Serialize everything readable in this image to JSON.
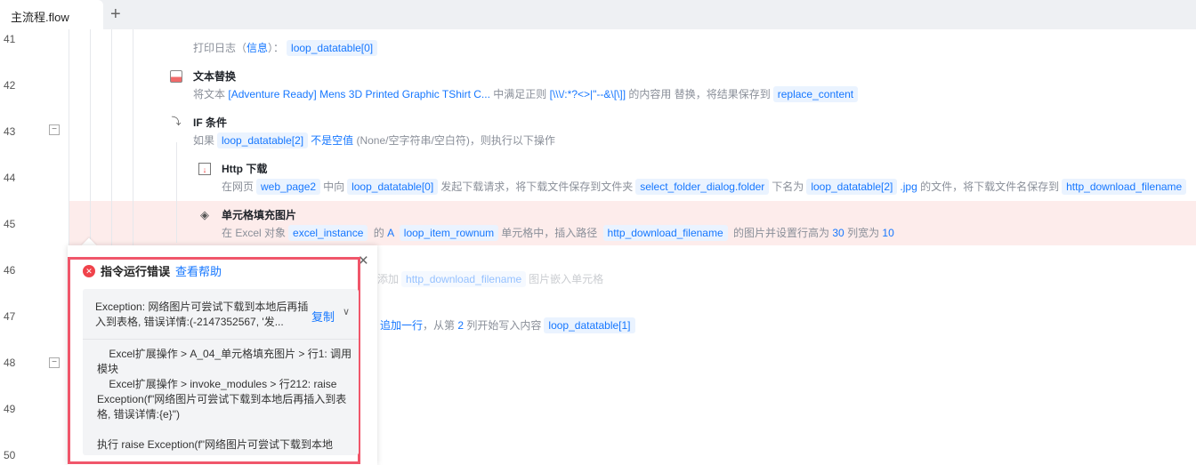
{
  "tabs": {
    "active": "主流程.flow",
    "add": "+"
  },
  "line_numbers": [
    "41",
    "42",
    "43",
    "44",
    "45",
    "46",
    "47",
    "48",
    "49",
    "50"
  ],
  "rows": {
    "r41": {
      "desc_prefix": "打印日志（",
      "level": "信息",
      "desc_mid": "）：",
      "var": "loop_datatable[0]"
    },
    "r42": {
      "title": "文本替换",
      "p1": "将文本",
      "text": "[Adventure Ready] Mens 3D Printed Graphic TShirt C...",
      "p2": "中满足正则",
      "regex": "[\\\\\\/:*?<>|\"--&\\[\\]]",
      "p3": "的内容用  替换，将结果保存到",
      "var": "replace_content"
    },
    "r43": {
      "title": "IF 条件",
      "p1": "如果",
      "var": "loop_datatable[2]",
      "cond": "不是空值",
      "p2": "(None/空字符串/空白符)，则执行以下操作"
    },
    "r44": {
      "title": "Http 下载",
      "p1": "在网页",
      "v1": "web_page2",
      "p2": "中向",
      "v2": "loop_datatable[0]",
      "p3": "发起下载请求，将下载文件保存到文件夹",
      "v3": "select_folder_dialog.folder",
      "p4": "下名为",
      "v4": "loop_datatable[2]",
      "ext": ".jpg",
      "p5": "的文件，将下载文件名保存到",
      "v5": "http_download_filename"
    },
    "r45": {
      "title": "单元格填充图片",
      "p1": "在 Excel 对象",
      "v1": "excel_instance",
      "p2": "的",
      "col": "A",
      "v2": "loop_item_rownum",
      "p3": "单元格中，插入路径",
      "v3": "http_download_filename",
      "p4": "的图片并设置行高为",
      "h": "30",
      "p5": "列宽为",
      "w": "10"
    },
    "r46": {
      "p1": "添加",
      "var": "http_download_filename",
      "p2": "图片嵌入单元格"
    },
    "r47": {
      "action": "追加一行",
      "p1": "，从第",
      "n": "2",
      "p2": "列开始写入内容",
      "var": "loop_datatable[1]"
    }
  },
  "popup": {
    "title": "指令运行错误",
    "help": "查看帮助",
    "message": "Exception: 网络图片可尝试下载到本地后再插入到表格, 错误详情:(-2147352567, '发...",
    "copy": "复制",
    "trace": "    Excel扩展操作 > A_04_单元格填充图片 > 行1: 调用模块\n    Excel扩展操作 > invoke_modules > 行212: raise Exception(f\"网络图片可尝试下载到本地后再插入到表格, 错误详情:{e}\")\n\n执行 raise Exception(f\"网络图片可尝试下载到本地"
  }
}
